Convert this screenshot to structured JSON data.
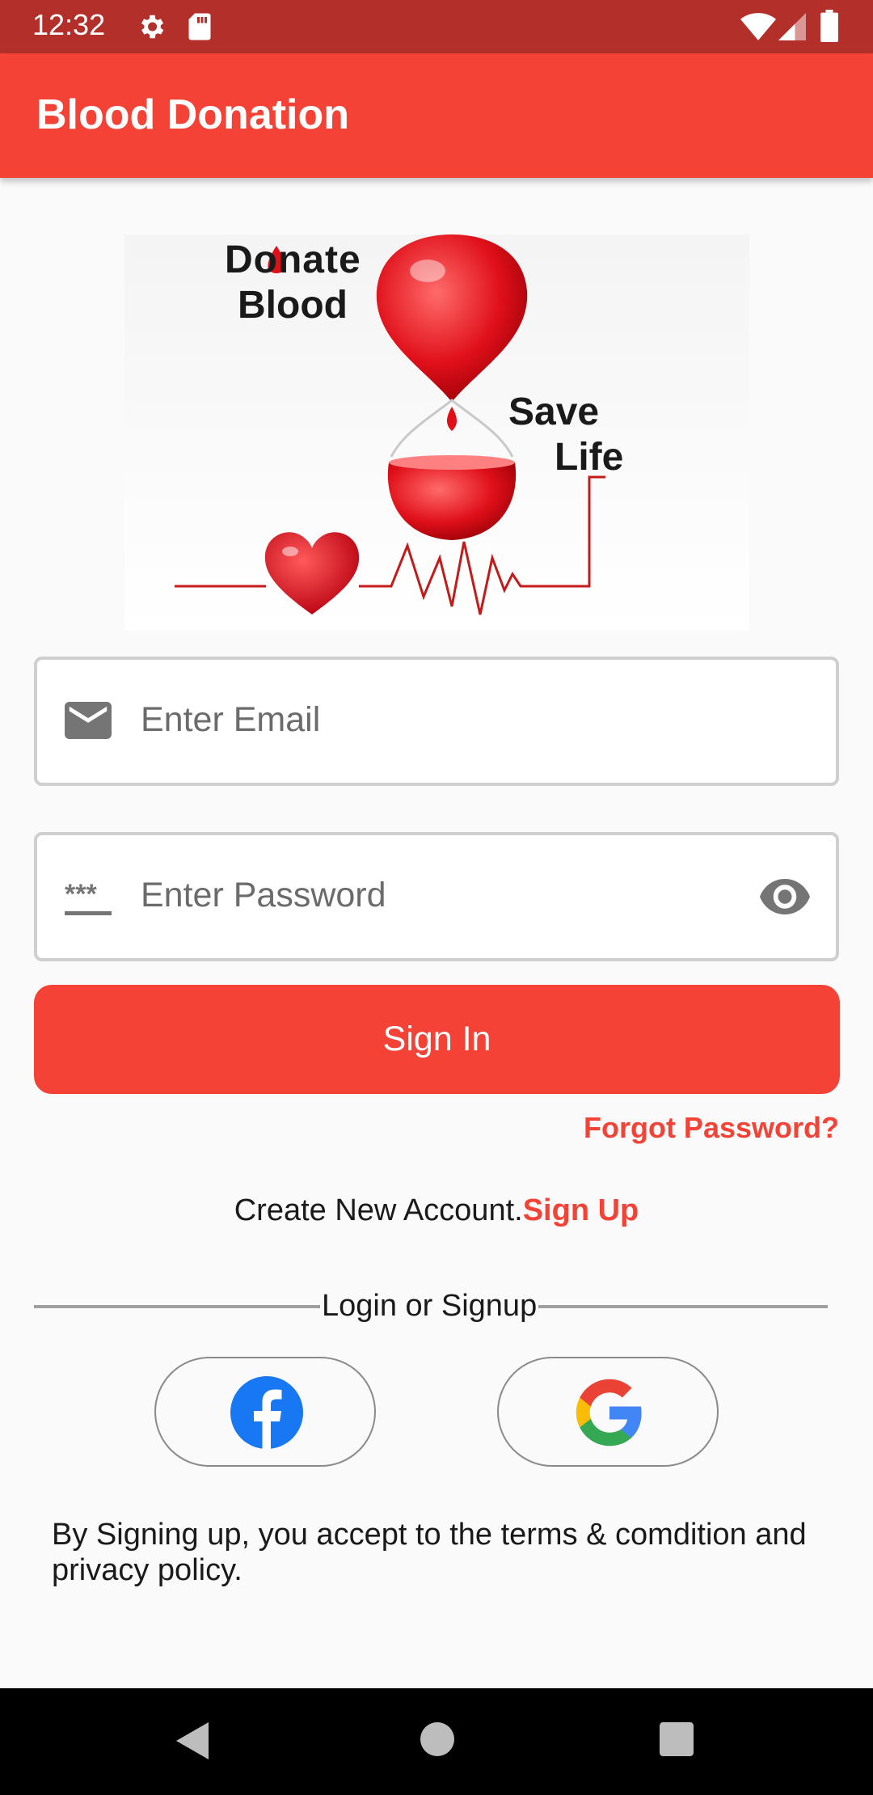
{
  "status_bar": {
    "time": "12:32",
    "icons": [
      "gear-icon",
      "sd-card-icon",
      "wifi-icon",
      "signal-icon",
      "battery-icon"
    ]
  },
  "app_bar": {
    "title": "Blood Donation"
  },
  "banner": {
    "line1": "Donate",
    "line2": "Blood",
    "line3": "Save",
    "line4": "Life"
  },
  "email_field": {
    "placeholder": "Enter Email",
    "icon": "email-icon"
  },
  "password_field": {
    "placeholder": "Enter Password",
    "icon": "password-icon",
    "toggle_icon": "eye-icon"
  },
  "sign_in": {
    "label": "Sign In"
  },
  "forgot_password": {
    "label": "Forgot Password?"
  },
  "create_account": {
    "text": "Create New Account.",
    "link": "Sign Up"
  },
  "divider": {
    "label": "Login or Signup"
  },
  "social": {
    "facebook_icon": "facebook-icon",
    "google_icon": "google-icon"
  },
  "terms": {
    "text": "By Signing up, you accept to the terms & comdition and privacy policy."
  },
  "colors": {
    "primary": "#f44336",
    "status_bar": "#b3302a",
    "nav_bar": "#000000"
  }
}
